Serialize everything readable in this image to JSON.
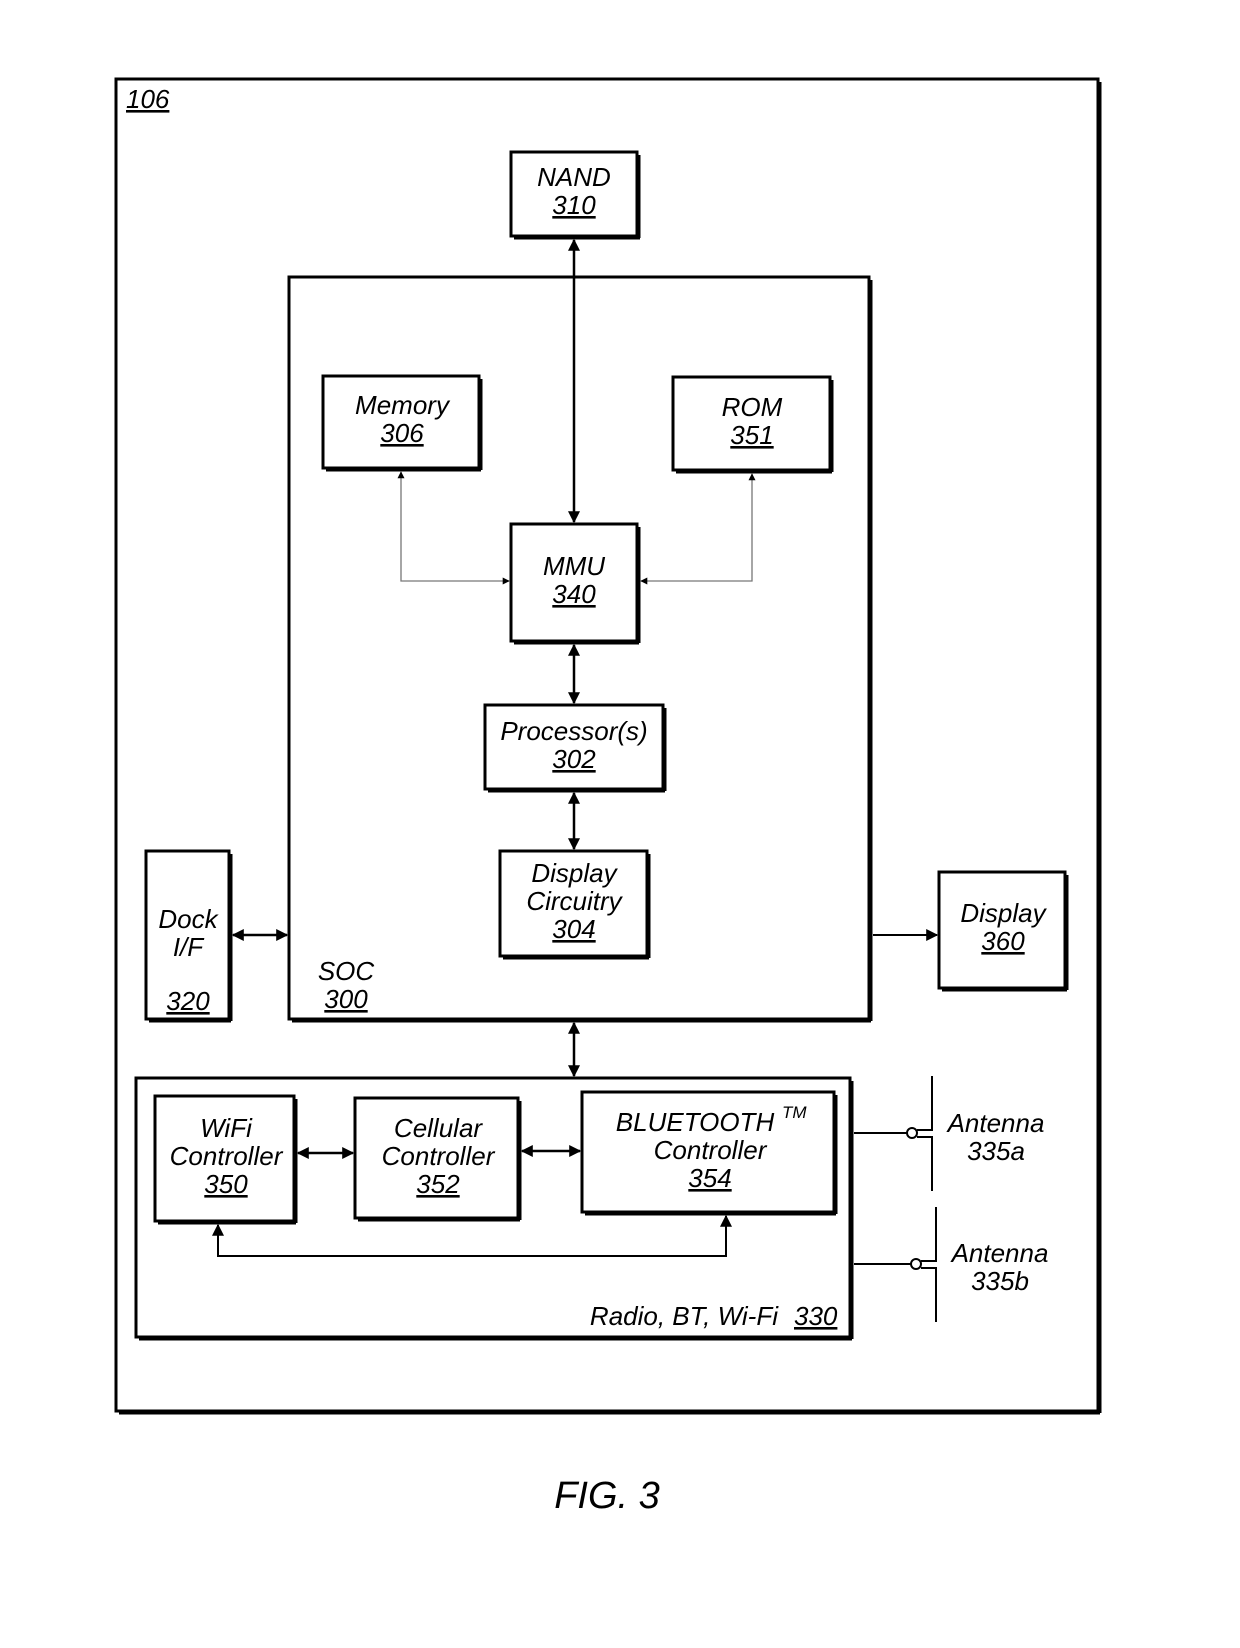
{
  "figure": {
    "caption": "FIG. 3",
    "device_ref": "106"
  },
  "blocks": {
    "nand": {
      "name": "NAND",
      "ref": "310"
    },
    "soc": {
      "name": "SOC",
      "ref": "300"
    },
    "memory": {
      "name": "Memory",
      "ref": "306"
    },
    "rom": {
      "name": "ROM",
      "ref": "351"
    },
    "mmu": {
      "name": "MMU",
      "ref": "340"
    },
    "processor": {
      "name": "Processor(s)",
      "ref": "302"
    },
    "display_circuitry": {
      "name_line1": "Display",
      "name_line2": "Circuitry",
      "ref": "304"
    },
    "dock": {
      "name_line1": "Dock",
      "name_line2": "I/F",
      "ref": "320"
    },
    "display": {
      "name": "Display",
      "ref": "360"
    },
    "radio": {
      "name": "Radio, BT, Wi-Fi",
      "ref": "330"
    },
    "wifi": {
      "name_line1": "WiFi",
      "name_line2": "Controller",
      "ref": "350"
    },
    "cellular": {
      "name_line1": "Cellular",
      "name_line2": "Controller",
      "ref": "352"
    },
    "bluetooth": {
      "name_line1": "BLUETOOTH",
      "trademark": "TM",
      "name_line2": "Controller",
      "ref": "354"
    },
    "antenna_a": {
      "name": "Antenna",
      "ref": "335a"
    },
    "antenna_b": {
      "name": "Antenna",
      "ref": "335b"
    }
  }
}
